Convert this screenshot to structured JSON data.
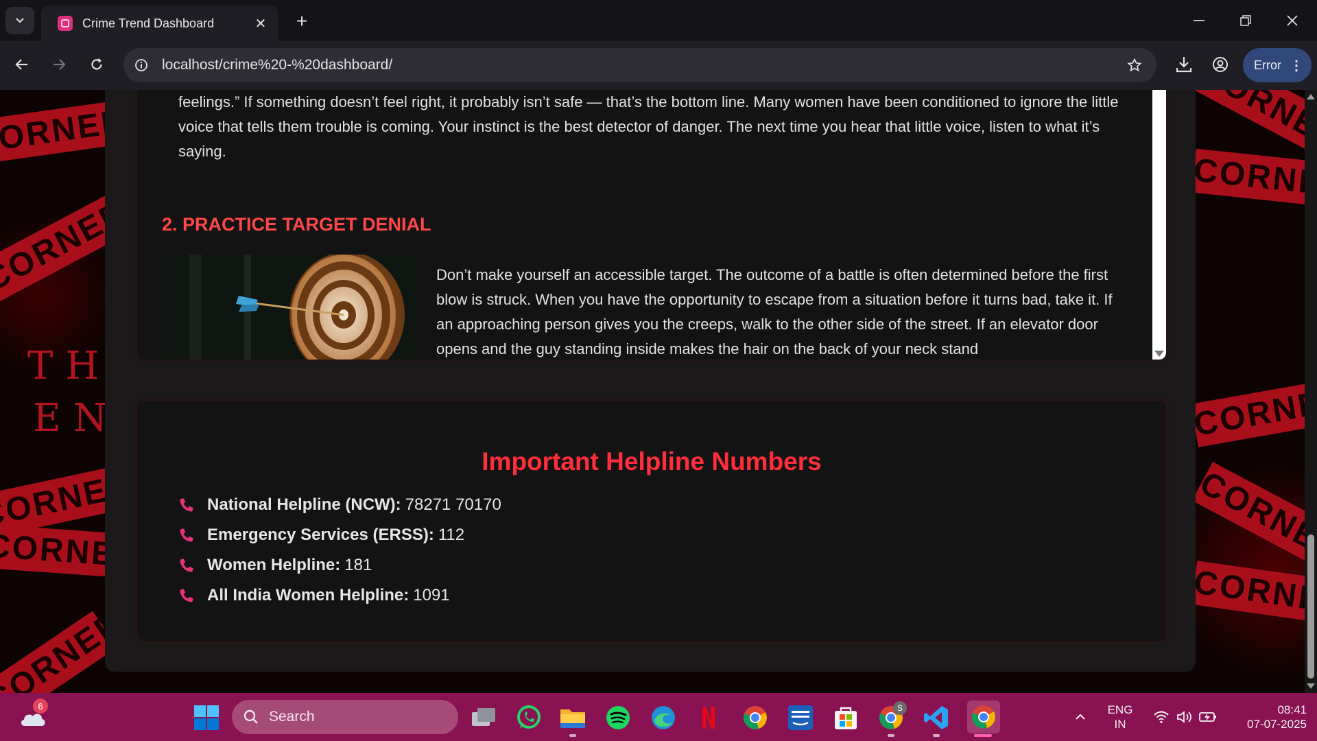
{
  "browser": {
    "tab_title": "Crime Trend Dashboard",
    "url": "localhost/crime%20-%20dashboard/",
    "profile_button": "Error"
  },
  "background": {
    "tape_words": [
      "CORNER",
      "CORNER",
      "CORNER",
      "CORNER",
      "CORNER",
      "CORNER",
      "CORNER",
      "CORNER",
      "CORNER",
      "CORNER"
    ],
    "side_text": [
      "THE",
      "EN"
    ]
  },
  "article": {
    "para1": "feelings.” If something doesn’t feel right, it probably isn’t safe — that’s the bottom line. Many women have been conditioned to ignore the little voice that tells them trouble is coming. Your instinct is the best detector of danger. The next time you hear that little voice, listen to what it’s saying.",
    "heading2": "2. PRACTICE TARGET DENIAL",
    "para2": "Don’t make yourself an accessible target. The outcome of a battle is often determined before the first blow is struck. When you have the opportunity to escape from a situation before it turns bad, take it. If an approaching person gives you the creeps, walk to the other side of the street. If an elevator door opens and the guy standing inside makes the hair on the back of your neck stand"
  },
  "helpline": {
    "title": "Important Helpline Numbers",
    "items": [
      {
        "label": "National Helpline (NCW):",
        "number": "78271 70170"
      },
      {
        "label": "Emergency Services (ERSS):",
        "number": "112"
      },
      {
        "label": "Women Helpline:",
        "number": "181"
      },
      {
        "label": "All India Women Helpline:",
        "number": "1091"
      }
    ]
  },
  "taskbar": {
    "weather_badge": "6",
    "search_placeholder": "Search",
    "chrome_profile_badge": "S",
    "lang_line1": "ENG",
    "lang_line2": "IN",
    "time": "08:41",
    "date": "07-07-2025"
  },
  "colors": {
    "accent_red": "#ff2e3a",
    "heading_red": "#ff4747",
    "phone_pink": "#e8337a",
    "taskbar": "#891252"
  }
}
